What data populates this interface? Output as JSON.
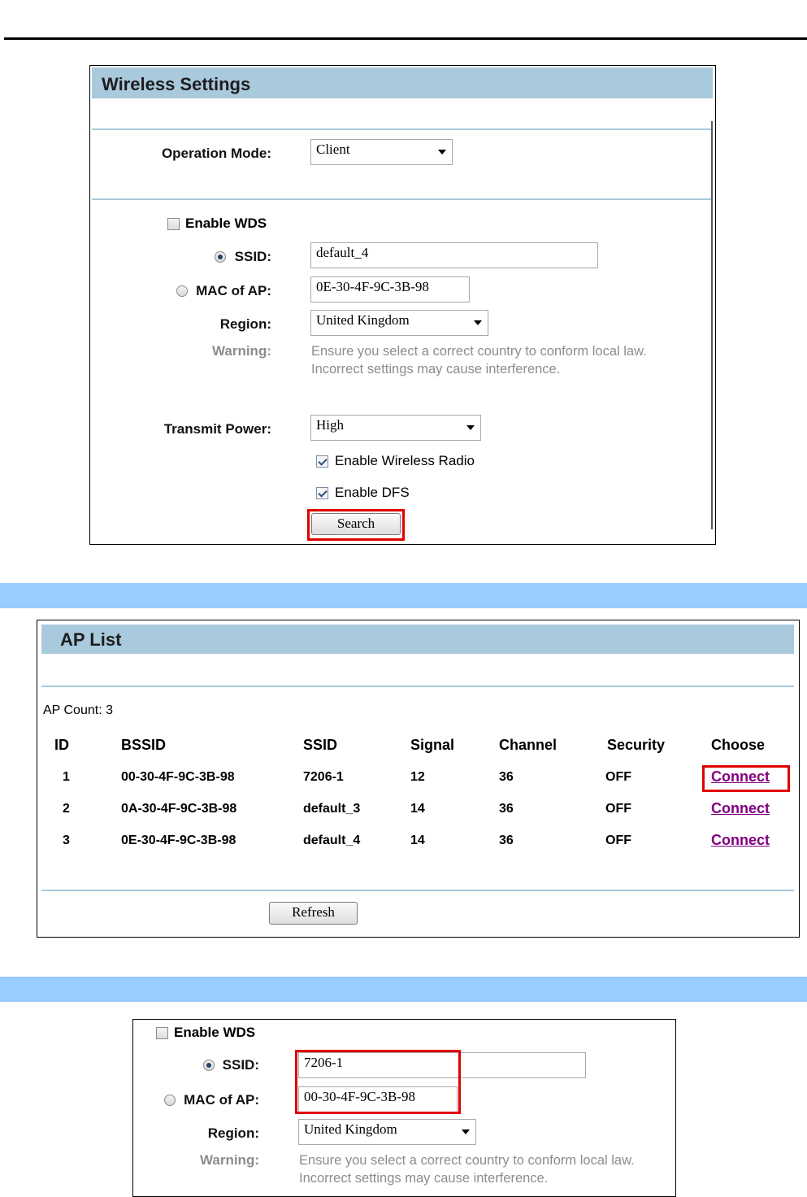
{
  "wireless_settings": {
    "title": "Wireless Settings",
    "operation_mode_label": "Operation Mode:",
    "operation_mode_value": "Client",
    "enable_wds_label": "Enable WDS",
    "ssid_label": "SSID:",
    "ssid_value": "default_4",
    "mac_label": "MAC of AP:",
    "mac_value": "0E-30-4F-9C-3B-98",
    "region_label": "Region:",
    "region_value": "United Kingdom",
    "warning_label": "Warning:",
    "warning_line1": "Ensure you select a correct country to conform local law.",
    "warning_line2": "Incorrect settings may cause interference.",
    "transmit_power_label": "Transmit Power:",
    "transmit_power_value": "High",
    "enable_radio_label": "Enable Wireless Radio",
    "enable_dfs_label": "Enable DFS",
    "search_button": "Search"
  },
  "ap_list": {
    "title": "AP List",
    "count_text": "AP Count: 3",
    "columns": [
      "ID",
      "BSSID",
      "SSID",
      "Signal",
      "Channel",
      "Security",
      "Choose"
    ],
    "rows": [
      [
        "1",
        "00-30-4F-9C-3B-98",
        "7206-1",
        "12",
        "36",
        "OFF",
        "Connect"
      ],
      [
        "2",
        "0A-30-4F-9C-3B-98",
        "default_3",
        "14",
        "36",
        "OFF",
        "Connect"
      ],
      [
        "3",
        "0E-30-4F-9C-3B-98",
        "default_4",
        "14",
        "36",
        "OFF",
        "Connect"
      ]
    ],
    "refresh_button": "Refresh"
  },
  "wds_result": {
    "enable_wds_label": "Enable WDS",
    "ssid_label": "SSID:",
    "ssid_value": "7206-1",
    "mac_label": "MAC of AP:",
    "mac_value": "00-30-4F-9C-3B-98",
    "region_label": "Region:",
    "region_value": "United Kingdom",
    "warning_label": "Warning:",
    "warning_line1": "Ensure you select a correct country to conform local law.",
    "warning_line2": "Incorrect settings may cause interference."
  },
  "colors": {
    "title_bar": "#a9c9dc",
    "section_band": "#99ccff",
    "highlight": "#e00000",
    "link": "#800080",
    "warning_text": "#8c8c8c"
  }
}
